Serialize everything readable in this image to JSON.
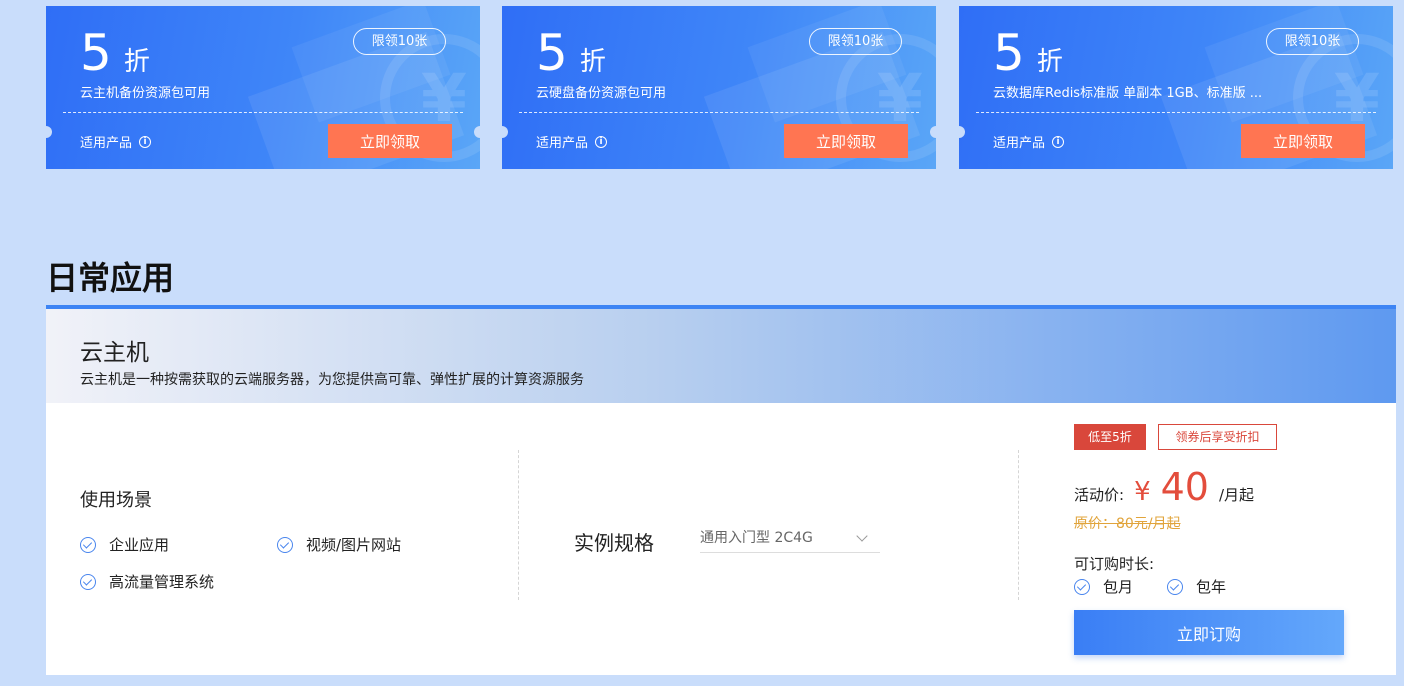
{
  "coupons": [
    {
      "discount_num": "5",
      "discount_unit": "折",
      "limit": "限领10张",
      "desc": "云主机备份资源包可用",
      "apply_label": "适用产品",
      "claim_label": "立即领取"
    },
    {
      "discount_num": "5",
      "discount_unit": "折",
      "limit": "限领10张",
      "desc": "云硬盘备份资源包可用",
      "apply_label": "适用产品",
      "claim_label": "立即领取"
    },
    {
      "discount_num": "5",
      "discount_unit": "折",
      "limit": "限领10张",
      "desc": "云数据库Redis标准版 单副本 1GB、标准版 ...",
      "apply_label": "适用产品",
      "claim_label": "立即领取"
    }
  ],
  "section": {
    "title": "日常应用"
  },
  "product": {
    "name": "云主机",
    "desc": "云主机是一种按需获取的云端服务器，为您提供高可靠、弹性扩展的计算资源服务",
    "usage_title": "使用场景",
    "usage_items": [
      "企业应用",
      "视频/图片网站",
      "高流量管理系统"
    ],
    "spec_label": "实例规格",
    "spec_value": "通用入门型 2C4G",
    "tag_discount": "低至5折",
    "tag_coupon": "领券后享受折扣",
    "price_label": "活动价:",
    "price_currency": "¥",
    "price_value": "40",
    "price_unit": "/月起",
    "original_price": "原价：80元/月起",
    "duration_label": "可订购时长:",
    "durations": [
      "包月",
      "包年"
    ],
    "order_label": "立即订购"
  },
  "colors": {
    "accent": "#3d84f4",
    "claim": "#ff7552",
    "price": "#e34d3c",
    "tag": "#d9473b",
    "background": "#c9ddfb"
  },
  "icons": {
    "info": "info-icon",
    "check": "check-circle-icon",
    "chevron": "chevron-down-icon",
    "coupon_watermark": "yen-icon"
  }
}
